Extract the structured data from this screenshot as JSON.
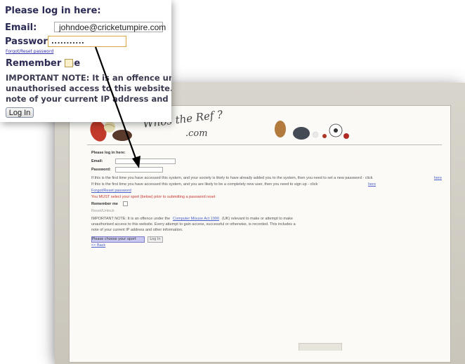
{
  "zoom": {
    "title": "Please log in here:",
    "email_label": "Email:",
    "email_value": "johndoe@cricketumpire.com",
    "password_label": "Password:",
    "password_value": "...........",
    "forgot_link": "Forgot/Reset password",
    "remember_label": "Remember me",
    "note_lines": [
      "IMPORTANT NOTE: It is an offence under th",
      "unauthorised access to this website. Every atte",
      "note of your current IP address and other info"
    ],
    "login_button": "Log In"
  },
  "site": {
    "logo_word": "Whos the Ref ?",
    "logo_domain": ".com"
  },
  "page": {
    "title": "Please log in here:",
    "email_label": "Email:",
    "password_label": "Password:",
    "first_time_line_1": "If this is the first time you have accessed this system, and your society is likely to have already added you to the system, then you need to set a new password - click",
    "first_time_link_1": "here",
    "first_time_line_2": "If this is the first time you have accessed this system, and you are likely to be a completely new user, then you need to sign up - click",
    "first_time_link_2": "here",
    "forgot_link": "Forgot/Reset password",
    "warning": "You MUST select your sport (below) prior to submitting a password reset",
    "remember_label": "Remember me",
    "sub_link": "Reset/Unlock",
    "note_line_1": "IMPORTANT NOTE: It is an offence under the",
    "note_link": "Computer Misuse Act 1990",
    "note_line_1b": "(UK) relevant to make or attempt to make",
    "note_line_2": "unauthorised access to this website. Every attempt to gain access, successful or otherwise, is recorded. This includes a",
    "note_line_3": "note of your current IP address and other information.",
    "sport_select": "Please choose your sport",
    "submit_button": "Log In",
    "back_link": "<< Back"
  },
  "colors": {
    "accent_link": "#2f2fb0",
    "warning": "#c8332b",
    "password_border": "#d8a649"
  }
}
